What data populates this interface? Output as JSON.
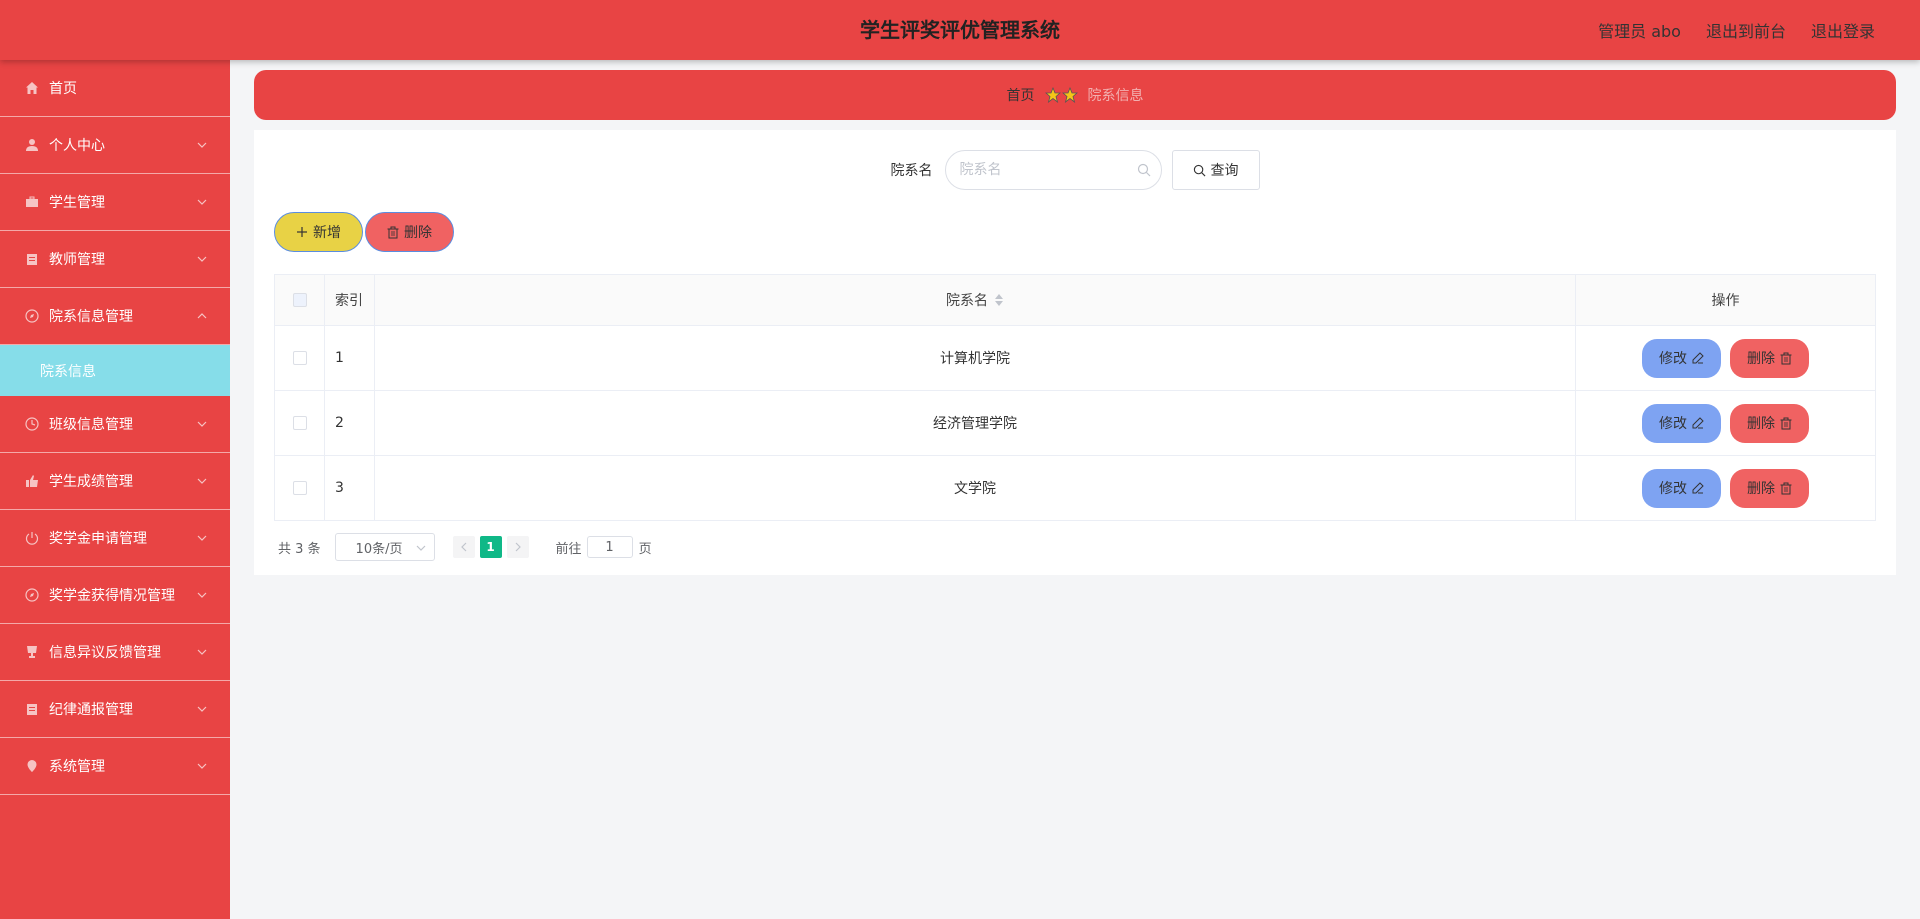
{
  "header": {
    "title": "学生评奖评优管理系统",
    "admin": "管理员 abo",
    "to_front": "退出到前台",
    "logout": "退出登录"
  },
  "sidebar": {
    "items": [
      {
        "label": "首页",
        "icon": "home-icon"
      },
      {
        "label": "个人中心",
        "icon": "user-icon"
      },
      {
        "label": "学生管理",
        "icon": "briefcase-icon"
      },
      {
        "label": "教师管理",
        "icon": "clipboard-icon"
      },
      {
        "label": "院系信息管理",
        "icon": "compass-icon"
      },
      {
        "label": "班级信息管理",
        "icon": "clock-icon"
      },
      {
        "label": "学生成绩管理",
        "icon": "thumbs-up-icon"
      },
      {
        "label": "奖学金申请管理",
        "icon": "power-icon"
      },
      {
        "label": "奖学金获得情况管理",
        "icon": "compass-icon"
      },
      {
        "label": "信息异议反馈管理",
        "icon": "cup-icon"
      },
      {
        "label": "纪律通报管理",
        "icon": "clipboard-icon"
      },
      {
        "label": "系统管理",
        "icon": "location-icon"
      }
    ],
    "active_sub": "院系信息"
  },
  "breadcrumb": {
    "home": "首页",
    "current": "院系信息"
  },
  "search": {
    "label": "院系名",
    "placeholder": "院系名",
    "query_label": "查询"
  },
  "actions": {
    "add_label": "新增",
    "delete_label": "删除"
  },
  "table": {
    "headers": {
      "index": "索引",
      "name": "院系名",
      "ops": "操作"
    },
    "rows": [
      {
        "index": "1",
        "name": "计算机学院"
      },
      {
        "index": "2",
        "name": "经济管理学院"
      },
      {
        "index": "3",
        "name": "文学院"
      }
    ],
    "edit_label": "修改",
    "delete_label": "删除"
  },
  "pagination": {
    "total": "共 3 条",
    "page_size": "10条/页",
    "current_page": "1",
    "goto_label": "前往",
    "goto_value": "1",
    "page_suffix": "页"
  },
  "colors": {
    "brand_red": "#e84444",
    "active_sub_bg": "#86dde9",
    "add_button": "#e8d245",
    "delete_button": "#f06262",
    "edit_button": "#7ea3f2",
    "page_active": "#0fb887"
  }
}
